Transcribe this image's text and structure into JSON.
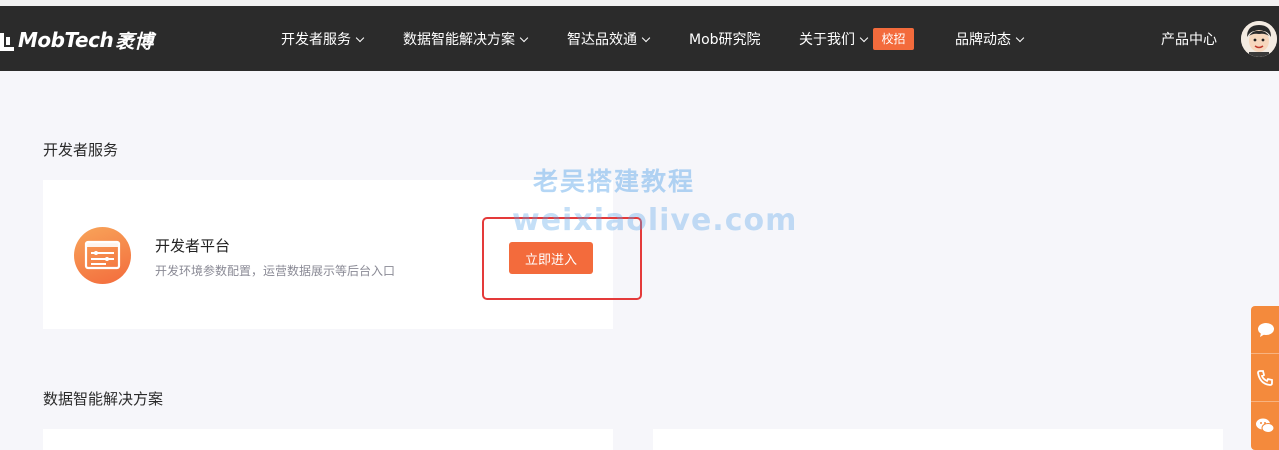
{
  "header": {
    "logo_text": "MobTech",
    "logo_cn": "袤博",
    "nav": [
      {
        "label": "开发者服务"
      },
      {
        "label": "数据智能解决方案"
      },
      {
        "label": "智达品效通"
      },
      {
        "label": "Mob研究院"
      },
      {
        "label": "关于我们"
      },
      {
        "label": "品牌动态"
      }
    ],
    "badge": "校招",
    "product_center": "产品中心"
  },
  "sections": [
    {
      "title": "开发者服务"
    },
    {
      "title": "数据智能解决方案"
    }
  ],
  "dev_card": {
    "title": "开发者平台",
    "desc": "开发环境参数配置，运营数据展示等后台入口",
    "button": "立即进入"
  },
  "watermark": {
    "line1": "老吴搭建教程",
    "line2": "weixiaolive.com"
  },
  "colors": {
    "nav_bg": "#2b2b2b",
    "accent": "#f36b3c",
    "highlight": "#e43a3a",
    "page_bg": "#f6f6fa"
  },
  "float_icons": [
    "chat-icon",
    "phone-icon",
    "wechat-icon"
  ]
}
